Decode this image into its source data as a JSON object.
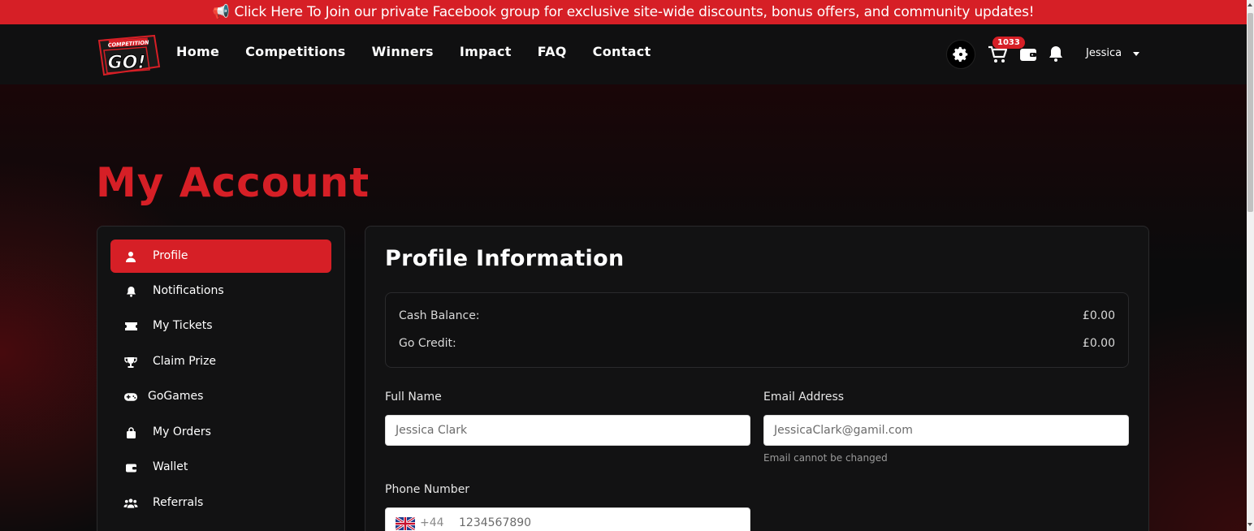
{
  "announcement": {
    "icon": "megaphone-icon",
    "text": "Click Here To Join our private Facebook group for exclusive site-wide discounts, bonus offers, and community updates!"
  },
  "navbar": {
    "logo_text": "COMPETITION GO!",
    "links": [
      "Home",
      "Competitions",
      "Winners",
      "Impact",
      "FAQ",
      "Contact"
    ],
    "cart_count": "1033",
    "user_name": "Jessica"
  },
  "page": {
    "title": "My Account"
  },
  "sidebar": {
    "items": [
      {
        "label": "Profile",
        "icon": "user-icon",
        "active": true
      },
      {
        "label": "Notifications",
        "icon": "bell-icon",
        "active": false
      },
      {
        "label": "My Tickets",
        "icon": "ticket-icon",
        "active": false
      },
      {
        "label": "Claim Prize",
        "icon": "trophy-icon",
        "active": false
      },
      {
        "label": "GoGames",
        "icon": "gamepad-icon",
        "active": false
      },
      {
        "label": "My Orders",
        "icon": "bag-icon",
        "active": false
      },
      {
        "label": "Wallet",
        "icon": "wallet-icon",
        "active": false
      },
      {
        "label": "Referrals",
        "icon": "users-icon",
        "active": false
      }
    ]
  },
  "profile": {
    "title": "Profile Information",
    "cash_balance_label": "Cash Balance:",
    "cash_balance_value": "£0.00",
    "go_credit_label": "Go Credit:",
    "go_credit_value": "£0.00",
    "full_name_label": "Full Name",
    "full_name_value": "Jessica Clark",
    "email_label": "Email Address",
    "email_value": "JessicaClark@gamil.com",
    "email_help": "Email cannot be changed",
    "phone_label": "Phone Number",
    "phone_code": "+44",
    "phone_value": "1234567890"
  },
  "colors": {
    "accent": "#d61f26",
    "background": "#0b0b0c",
    "panel": "#121213"
  }
}
